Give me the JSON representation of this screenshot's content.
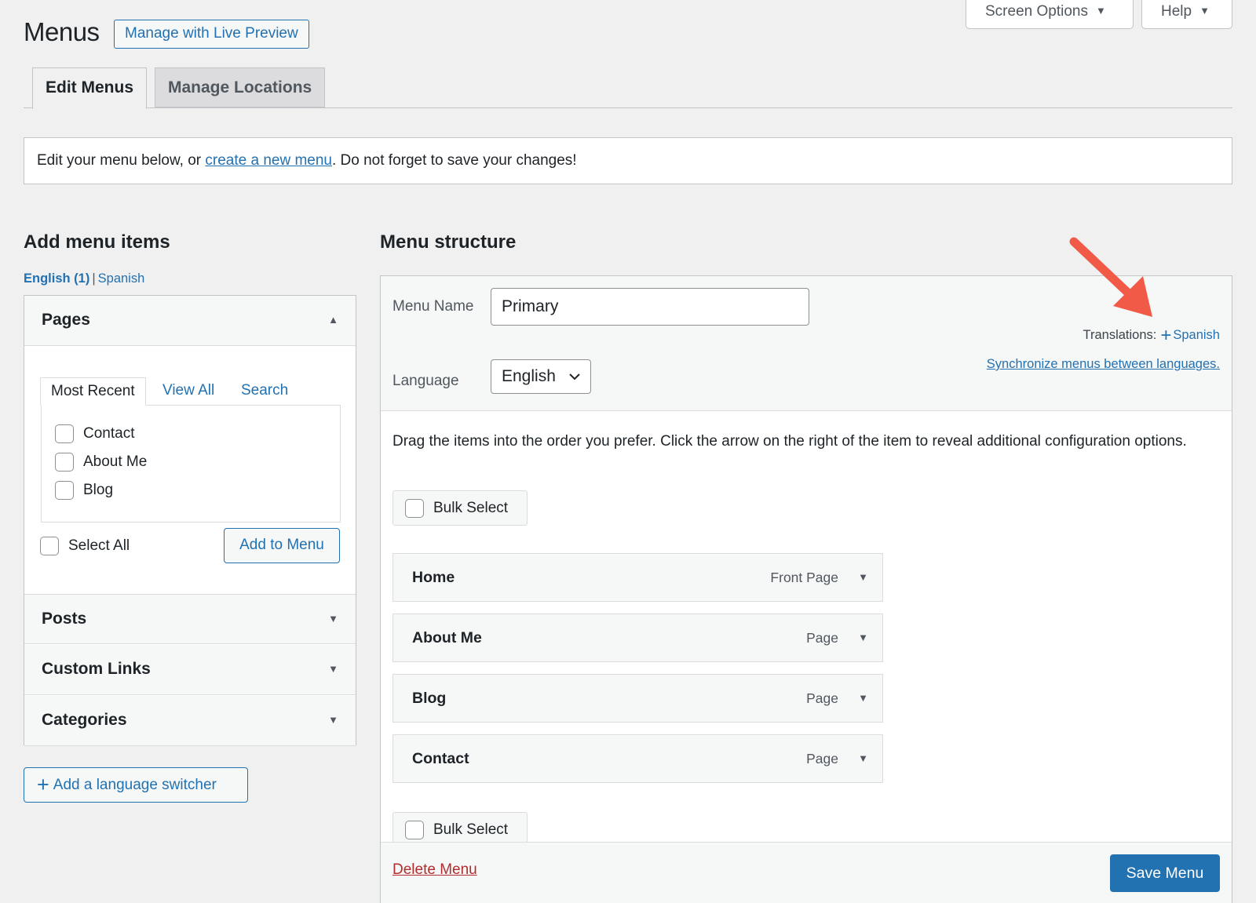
{
  "header": {
    "title": "Menus",
    "live_preview_label": "Manage with Live Preview",
    "screen_options_label": "Screen Options",
    "help_label": "Help"
  },
  "tabs": [
    {
      "label": "Edit Menus",
      "active": true
    },
    {
      "label": "Manage Locations",
      "active": false
    }
  ],
  "notice": {
    "before": "Edit your menu below, or ",
    "link": "create a new menu",
    "after": ". Do not forget to save your changes!"
  },
  "left": {
    "title": "Add menu items",
    "lang_current": "English (1)",
    "lang_sep": "|",
    "lang_other": "Spanish",
    "pages": {
      "title": "Pages",
      "tabs": [
        "Most Recent",
        "View All",
        "Search"
      ],
      "items": [
        "Contact",
        "About Me",
        "Blog"
      ],
      "select_all": "Select All",
      "add_button": "Add to Menu"
    },
    "sections": [
      "Posts",
      "Custom Links",
      "Categories"
    ],
    "lang_switcher_button": "Add a language switcher"
  },
  "right": {
    "title": "Menu structure",
    "menu_name_label": "Menu Name",
    "menu_name_value": "Primary",
    "language_label": "Language",
    "language_value": "English",
    "translations_label": "Translations:",
    "translations_link": "Spanish",
    "sync_link": "Synchronize menus between languages.",
    "drag_instructions": "Drag the items into the order you prefer. Click the arrow on the right of the item to reveal additional configuration options.",
    "bulk_select": "Bulk Select",
    "menu_items": [
      {
        "title": "Home",
        "type": "Front Page"
      },
      {
        "title": "About Me",
        "type": "Page"
      },
      {
        "title": "Blog",
        "type": "Page"
      },
      {
        "title": "Contact",
        "type": "Page"
      }
    ],
    "delete_menu": "Delete Menu",
    "save_menu": "Save Menu"
  },
  "colors": {
    "accent": "#2271b1",
    "danger": "#b32d2e",
    "annotation_arrow": "#f05a47"
  }
}
